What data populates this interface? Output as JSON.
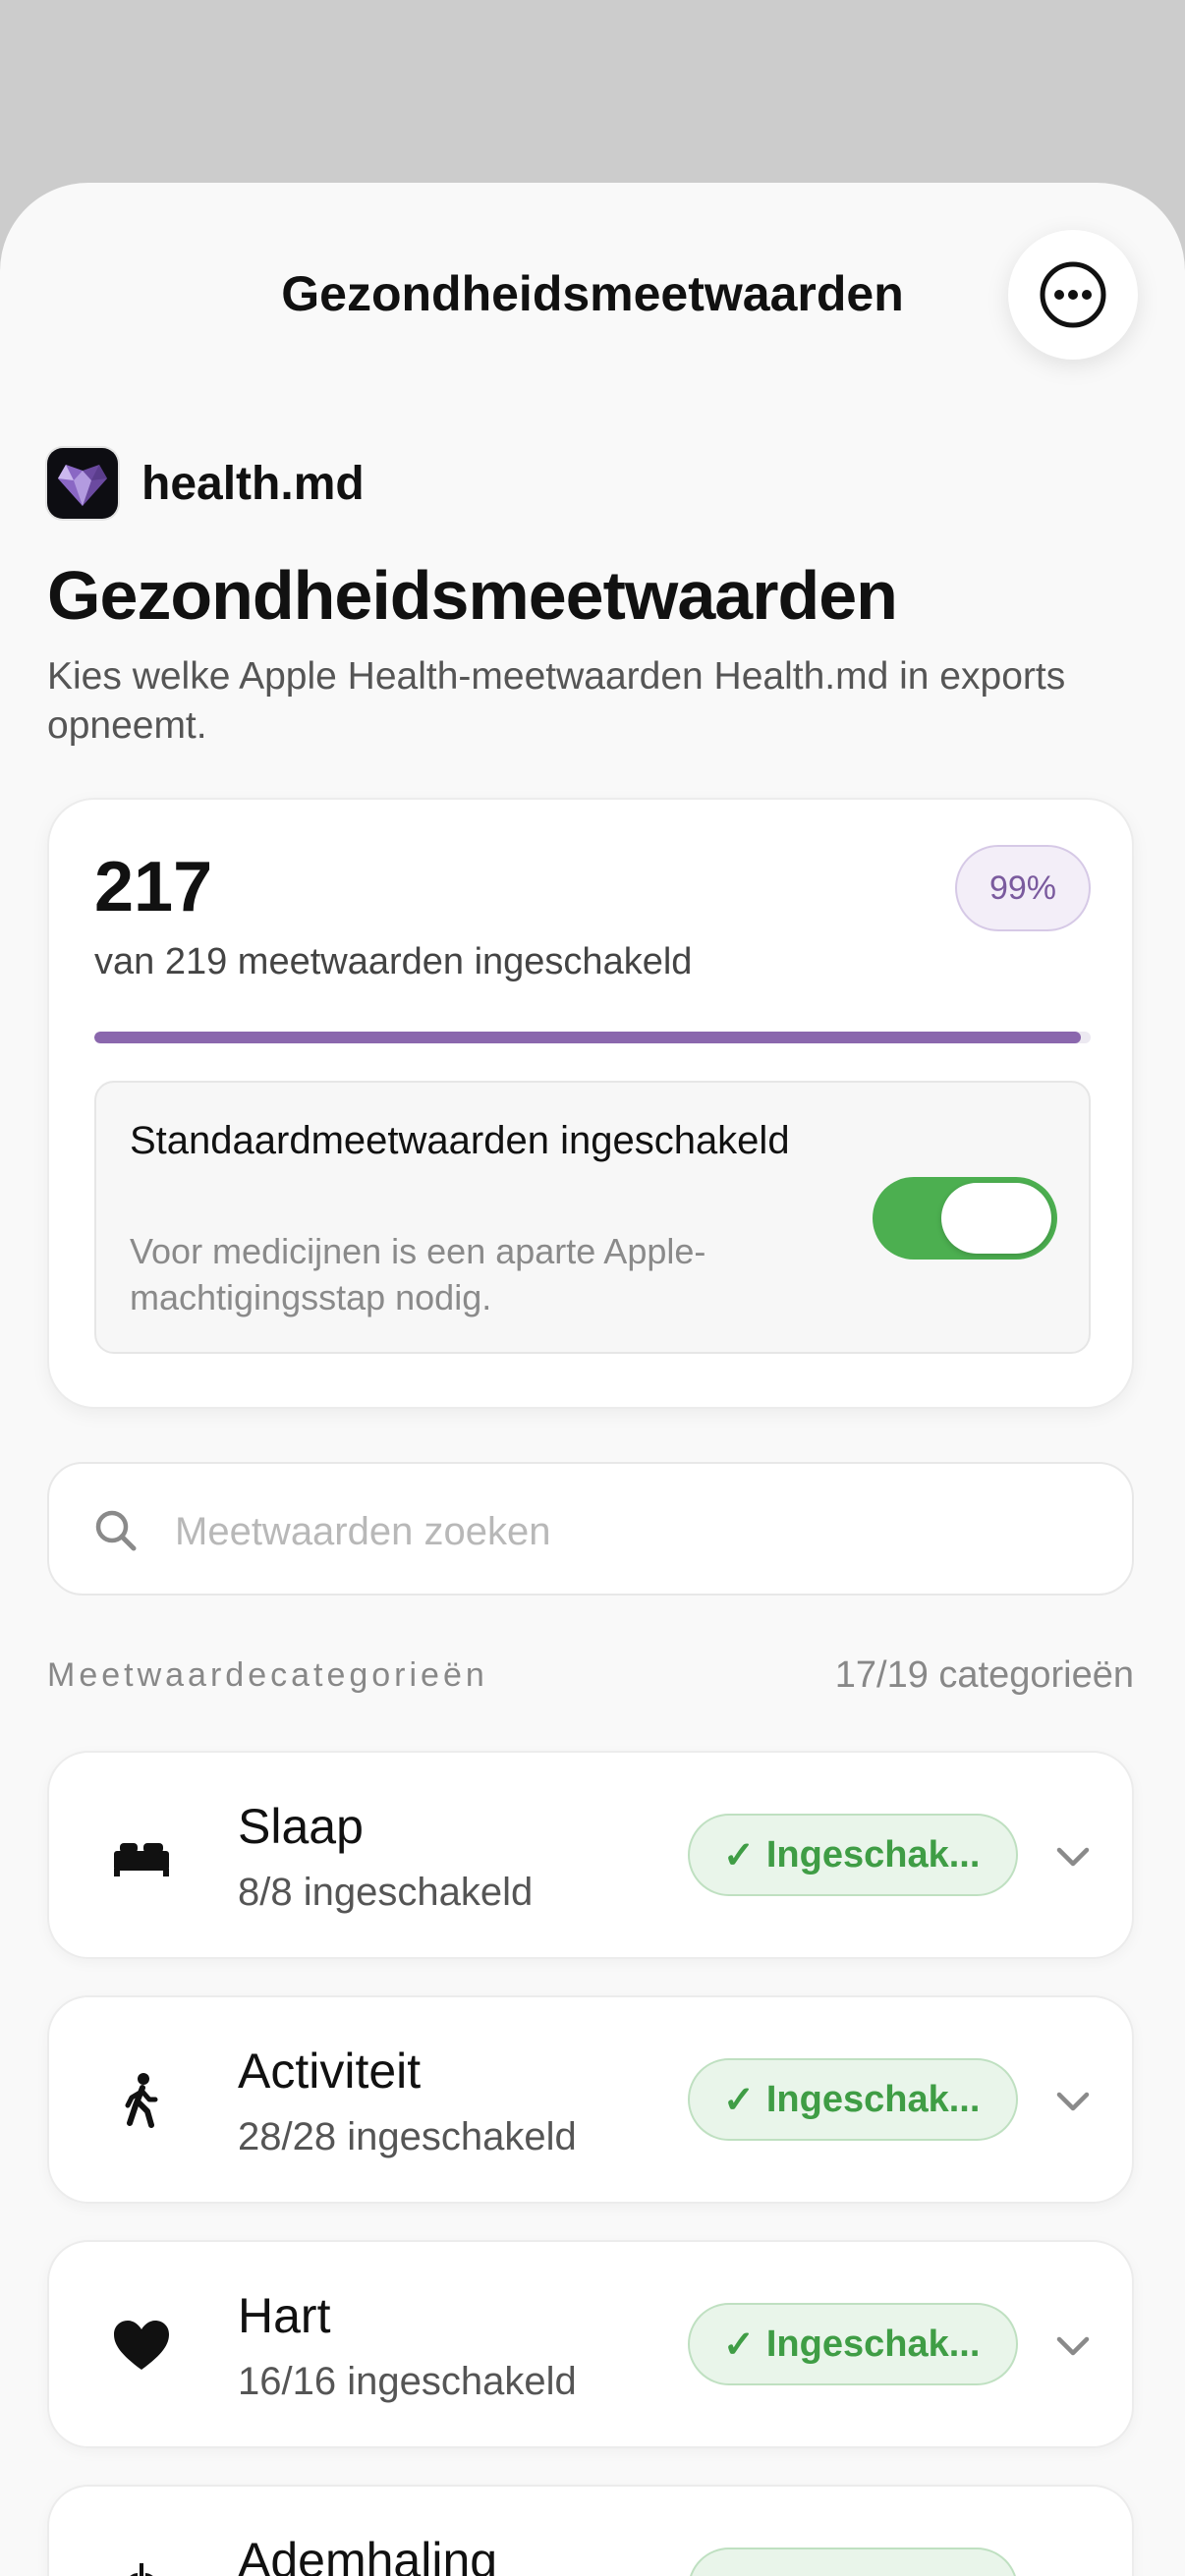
{
  "nav": {
    "title": "Gezondheidsmeetwaarden",
    "more_icon": "ellipsis-circle-icon"
  },
  "app": {
    "name": "health.md",
    "icon": "purple-heart-gem-icon"
  },
  "page": {
    "title": "Gezondheidsmeetwaarden",
    "subtitle": "Kies welke Apple Health-meetwaarden Health.md in exports opneemt."
  },
  "summary": {
    "count": "217",
    "description": "van 219 meetwaarden ingeschakeld",
    "percent_label": "99%",
    "progress_fraction": 0.99,
    "defaults_title": "Standaardmeetwaarden ingeschakeld",
    "defaults_note": "Voor medicijnen is een aparte Apple-machtigingsstap nodig.",
    "defaults_enabled": true
  },
  "search": {
    "placeholder": "Meetwaarden zoeken",
    "value": ""
  },
  "categories_section": {
    "label": "Meetwaardecategorieën",
    "count": "17/19 categorieën"
  },
  "categories": [
    {
      "name": "Slaap",
      "sub": "8/8 ingeschakeld",
      "badge": "Ingeschak...",
      "icon": "bed-icon"
    },
    {
      "name": "Activiteit",
      "sub": "28/28 ingeschakeld",
      "badge": "Ingeschak...",
      "icon": "figure-walk-icon"
    },
    {
      "name": "Hart",
      "sub": "16/16 ingeschakeld",
      "badge": "Ingeschak...",
      "icon": "heart-icon"
    },
    {
      "name": "Ademhaling",
      "sub": "",
      "badge": "",
      "icon": "lungs-icon"
    }
  ],
  "colors": {
    "accent": "#8a67ad",
    "toggle_on": "#4caf50",
    "badge_green": "#3f9d45"
  }
}
